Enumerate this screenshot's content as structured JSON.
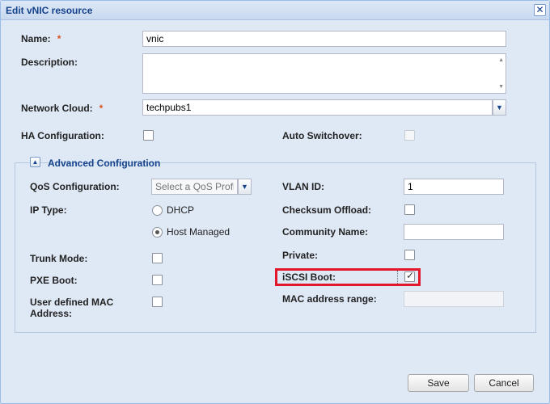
{
  "dialog": {
    "title": "Edit vNIC resource"
  },
  "form": {
    "name_label": "Name:",
    "name_value": "vnic",
    "required_mark": "*",
    "description_label": "Description:",
    "description_value": "",
    "network_cloud_label": "Network Cloud:",
    "network_cloud_value": "techpubs1",
    "ha_label": "HA Configuration:",
    "auto_switchover_label": "Auto Switchover:"
  },
  "advanced": {
    "legend": "Advanced Configuration",
    "qos_label": "QoS Configuration:",
    "qos_placeholder": "Select a QoS Profile",
    "vlan_label": "VLAN ID:",
    "vlan_value": "1",
    "ip_type_label": "IP Type:",
    "ip_options": [
      "DHCP",
      "Host Managed"
    ],
    "ip_selected": "Host Managed",
    "checksum_label": "Checksum Offload:",
    "community_label": "Community Name:",
    "community_value": "",
    "trunk_label": "Trunk Mode:",
    "private_label": "Private:",
    "pxe_label": "PXE Boot:",
    "iscsi_label": "iSCSI Boot:",
    "iscsi_checked": true,
    "mac_user_label_1": "User defined MAC",
    "mac_user_label_2": "Address:",
    "mac_range_label": "MAC address range:",
    "mac_range_value": ""
  },
  "buttons": {
    "save": "Save",
    "cancel": "Cancel"
  },
  "colors": {
    "highlight": "#e3162a",
    "title_text": "#15428b",
    "required": "#d9531e"
  }
}
